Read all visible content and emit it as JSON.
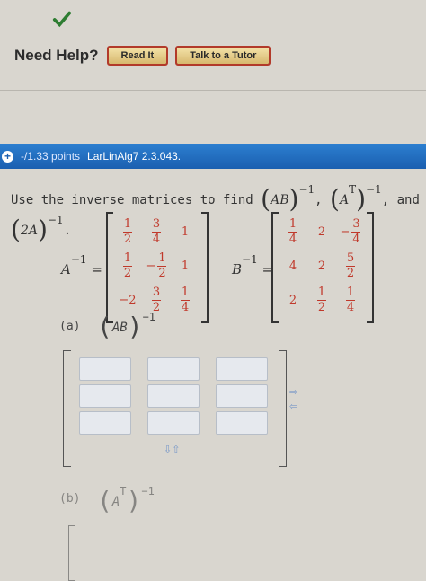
{
  "header": {
    "need_help": "Need Help?",
    "read_it": "Read It",
    "talk_tutor": "Talk to a Tutor"
  },
  "question_bar": {
    "points": "-/1.33 points",
    "code": "LarLinAlg7 2.3.043."
  },
  "question": {
    "text": "Use the inverse matrices to find",
    "expr1": "AB",
    "expr2": "A",
    "expr2_sup": "T",
    "expr3": "2A",
    "inv": "−1",
    "comma": ",",
    "and": "and",
    "end": "."
  },
  "matrices": {
    "a_label": "A",
    "a_sup": "−1",
    "eq": "=",
    "a_rows": [
      [
        {
          "n": "1",
          "d": "2"
        },
        {
          "n": "3",
          "d": "4"
        },
        {
          "v": "1"
        }
      ],
      [
        {
          "n": "1",
          "d": "2"
        },
        {
          "neg": true,
          "n": "1",
          "d": "2"
        },
        {
          "v": "1"
        }
      ],
      [
        {
          "v": "−2"
        },
        {
          "n": "3",
          "d": "2"
        },
        {
          "n": "1",
          "d": "4"
        }
      ]
    ],
    "b_label": "B",
    "b_sup": "−1",
    "b_rows": [
      [
        {
          "n": "1",
          "d": "4"
        },
        {
          "v": "2"
        },
        {
          "neg": true,
          "n": "3",
          "d": "4"
        }
      ],
      [
        {
          "v": "4"
        },
        {
          "v": "2"
        },
        {
          "n": "5",
          "d": "2"
        }
      ],
      [
        {
          "v": "2"
        },
        {
          "n": "1",
          "d": "2"
        },
        {
          "n": "1",
          "d": "4"
        }
      ]
    ]
  },
  "parts": {
    "a_label": "(a)",
    "a_expr": "AB",
    "a_sup": "−1",
    "b_label": "(b)",
    "b_expr": "A",
    "b_sup_t": "T",
    "b_sup": "−1"
  },
  "colors": {
    "bar": "#1b5fb0",
    "answer_red": "#c0392b",
    "check_green": "#2e7d32"
  }
}
